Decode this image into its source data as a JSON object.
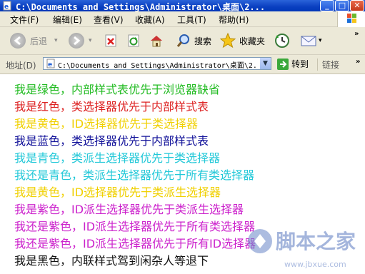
{
  "window": {
    "title": "C:\\Documents and Settings\\Administrator\\桌面\\2..."
  },
  "menu": [
    "文件(F)",
    "编辑(E)",
    "查看(V)",
    "收藏(A)",
    "工具(T)",
    "帮助(H)"
  ],
  "toolbar": {
    "back_label": "后退",
    "search_label": "搜索",
    "favorites_label": "收藏夹"
  },
  "address": {
    "label": "地址(D)",
    "value": "C:\\Documents and Settings\\Administrator\\桌面\\2.",
    "go_label": "转到",
    "links_label": "链接"
  },
  "content": {
    "lines": [
      {
        "text": "我是绿色，内部样式表优先于浏览器缺省",
        "color": "#22bb22"
      },
      {
        "text": "我是红色，类选择器优先于内部样式表",
        "color": "#dd2222"
      },
      {
        "text": "我是黄色，ID选择器优先于类选择器",
        "color": "#f0d000"
      },
      {
        "text": "我是蓝色，类选择器优先于内部样式表",
        "color": "#111199"
      },
      {
        "text": "我是青色，类派生选择器优先于类选择器",
        "color": "#22c8d8"
      },
      {
        "text": "我还是青色，类派生选择器优先于所有类选择器",
        "color": "#22c8d8"
      },
      {
        "text": "我是黄色，ID选择器优先于类派生选择器",
        "color": "#f0d000"
      },
      {
        "text": "我是紫色，ID派生选择器优先于类派生选择器",
        "color": "#cc22cc"
      },
      {
        "text": "我还是紫色，ID派生选择器优先于所有类选择器",
        "color": "#cc22cc"
      },
      {
        "text": "我还是紫色，ID派生选择器优先于所有ID选择器",
        "color": "#cc22cc"
      },
      {
        "text": "我是黑色，内联样式驾到闲杂人等退下",
        "color": "#111111"
      }
    ]
  },
  "watermark": {
    "text": "脚本之家",
    "url": "www.jbxue.com"
  }
}
